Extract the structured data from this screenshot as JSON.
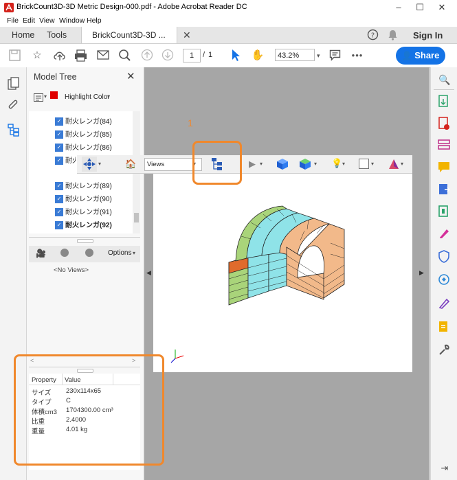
{
  "window": {
    "title": "BrickCount3D-3D Metric Design-000.pdf - Adobe Acrobat Reader DC",
    "minimize": "–",
    "maximize": "☐",
    "close": "✕"
  },
  "menu": [
    "File",
    "Edit",
    "View",
    "Window",
    "Help"
  ],
  "tabs": {
    "home": "Home",
    "tools": "Tools",
    "document": "BrickCount3D-3D ...",
    "signin": "Sign In"
  },
  "toolbar": {
    "page_current": "1",
    "page_sep": "/",
    "page_total": "1",
    "zoom": "43.2%",
    "share": "Share"
  },
  "model_tree": {
    "title": "Model Tree",
    "highlight_label": "Highlight Color",
    "items": [
      "耐火レンガ(84)",
      "耐火レンガ(85)",
      "耐火レンガ(86)",
      "耐火レンガ(88)",
      "耐火レンガ(89)",
      "耐火レンガ(90)",
      "耐火レンガ(91)",
      "耐火レンガ(92)"
    ],
    "options_label": "Options",
    "no_views": "<No Views>",
    "property_header": "Property",
    "value_header": "Value",
    "properties": [
      {
        "name": "サイズ",
        "value": "230x114x65"
      },
      {
        "name": "タイプ",
        "value": "C"
      },
      {
        "name": "体積cm3",
        "value": "1704300.00 cm³"
      },
      {
        "name": "比重",
        "value": "2.4000"
      },
      {
        "name": "重量",
        "value": "4.01 kg"
      }
    ]
  },
  "toolbar3d": {
    "views_label": "Views"
  },
  "annotation": {
    "number": "1"
  },
  "colors": {
    "accent": "#1473e6",
    "highlight": "#f0882c",
    "red_swatch": "#e00000"
  }
}
